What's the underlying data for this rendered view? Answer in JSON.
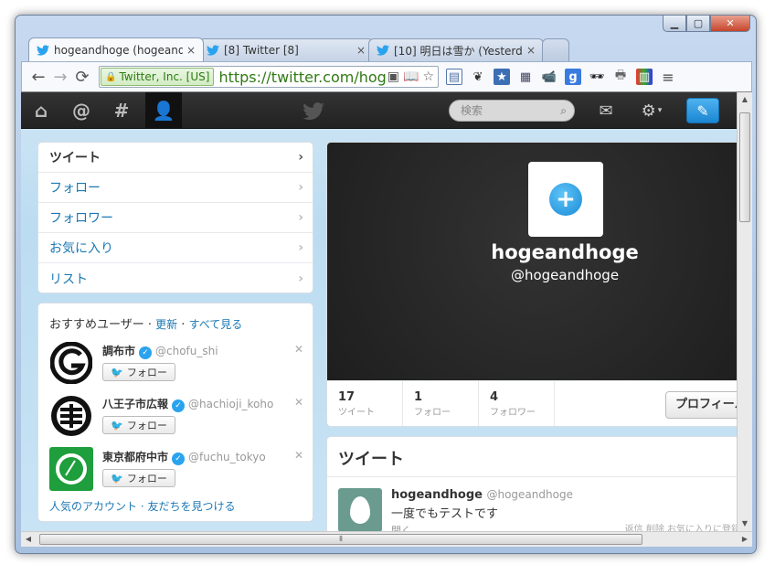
{
  "browser": {
    "tabs": [
      {
        "title": "hogeandhoge (hogeandho",
        "close": "×"
      },
      {
        "title": "[8] Twitter [8]",
        "close": "×"
      },
      {
        "title": "[10] 明日は雪か (Yesterd",
        "close": "×"
      }
    ],
    "ev_label": "Twitter, Inc. [US]",
    "url": "https://twitter.com/hogeandhoge"
  },
  "twitter": {
    "search_placeholder": "検索",
    "left_nav": [
      {
        "label": "ツイート"
      },
      {
        "label": "フォロー"
      },
      {
        "label": "フォロワー"
      },
      {
        "label": "お気に入り"
      },
      {
        "label": "リスト"
      }
    ],
    "suggest": {
      "title": "おすすめユーザー",
      "sep": " · ",
      "refresh": "更新",
      "see_all": "すべて見る",
      "follow_label": "フォロー",
      "users": [
        {
          "name": "調布市",
          "screen_name": "@chofu_shi"
        },
        {
          "name": "八王子市広報",
          "screen_name": "@hachioji_koho"
        },
        {
          "name": "東京都府中市",
          "screen_name": "@fuchu_tokyo"
        }
      ],
      "footer_popular": "人気のアカウント",
      "footer_friends": "友だちを見つける"
    },
    "profile": {
      "name": "hogeandhoge",
      "screen_name": "@hogeandhoge",
      "stats": [
        {
          "count": "17",
          "label": "ツイート"
        },
        {
          "count": "1",
          "label": "フォロー"
        },
        {
          "count": "4",
          "label": "フォロワー"
        }
      ],
      "profile_button": "プロフィール"
    },
    "tweets": {
      "header": "ツイート",
      "items": [
        {
          "name": "hogeandhoge",
          "screen_name": "@hogeandhoge",
          "text": "一度でもテストです",
          "open": "開く",
          "actions": "返信 削除 お気に入りに登録"
        }
      ]
    }
  },
  "colors": {
    "accent": "#2aa3ef",
    "link": "#1b78b4",
    "topbar": "#2b2b2b"
  }
}
